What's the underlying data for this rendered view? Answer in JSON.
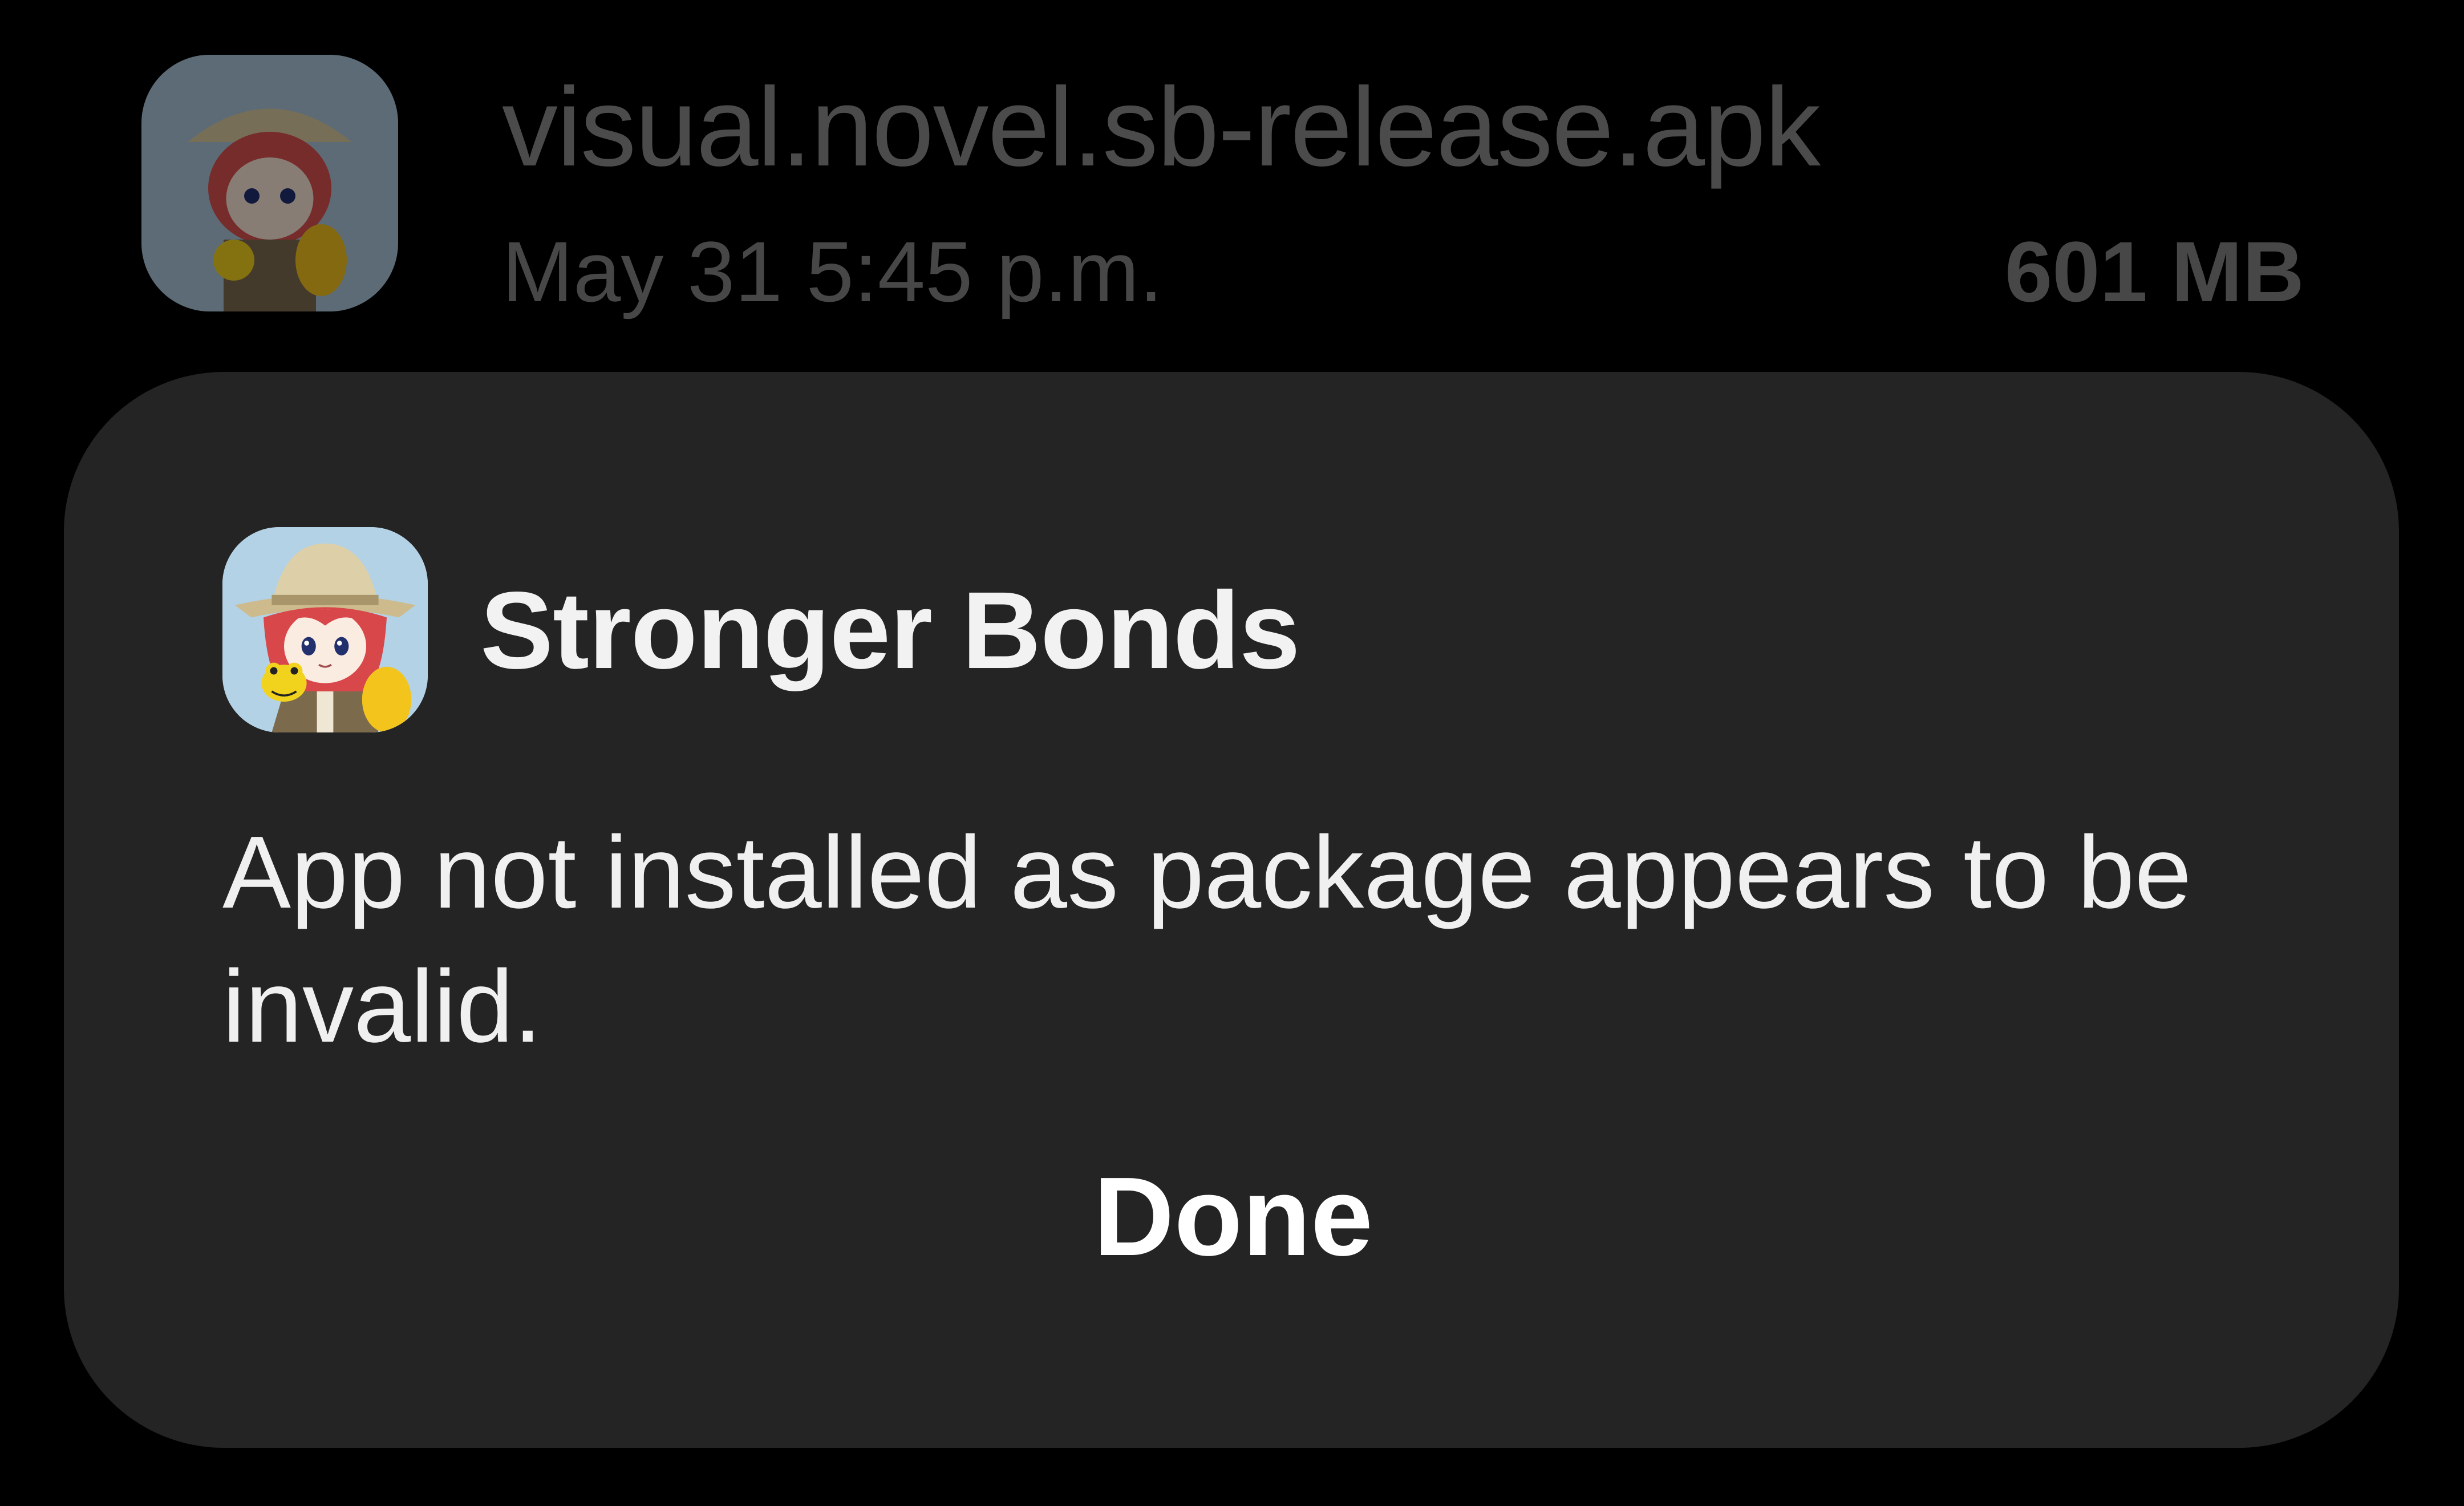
{
  "file_list_item": {
    "file_name": "visual.novel.sb-release.apk",
    "date": "May 31 5:45 p.m.",
    "size": "601 MB",
    "icon": "app-thumbnail-icon"
  },
  "dialog": {
    "app_icon": "app-icon",
    "app_name": "Stronger Bonds",
    "message": "App not installed as package appears to be invalid.",
    "done_label": "Done"
  },
  "colors": {
    "background": "#000000",
    "dialog_background": "#242424",
    "dialog_text": "#f0f0f0",
    "dimmed_text": "#4b4b4b"
  }
}
